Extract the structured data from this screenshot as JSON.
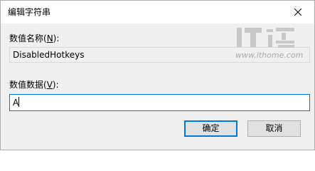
{
  "window": {
    "title": "编辑字符串",
    "close_icon": "close-icon"
  },
  "value_name": {
    "label_text": "数值名称(",
    "label_accel": "N",
    "label_suffix": "):",
    "value": "DisabledHotkeys"
  },
  "value_data": {
    "label_text": "数值数据(",
    "label_accel": "V",
    "label_suffix": "):",
    "value": "A"
  },
  "buttons": {
    "ok_label": "确定",
    "cancel_label": "取消"
  },
  "watermark": {
    "logo_text": "IT之家",
    "url": "www.ithome.com"
  },
  "colors": {
    "focus_border": "#0078d7",
    "dialog_bg": "#f0f0f0",
    "button_bg": "#e1e1e1"
  }
}
